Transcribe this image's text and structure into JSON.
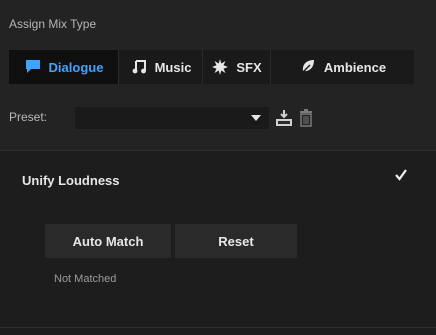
{
  "panel": {
    "title": "Assign Mix Type"
  },
  "tabs": [
    {
      "label": "Dialogue",
      "icon": "speech-bubble-icon",
      "active": true
    },
    {
      "label": "Music",
      "icon": "music-note-icon",
      "active": false
    },
    {
      "label": "SFX",
      "icon": "burst-icon",
      "active": false
    },
    {
      "label": "Ambience",
      "icon": "leaf-icon",
      "active": false
    }
  ],
  "preset": {
    "label": "Preset:",
    "value": ""
  },
  "unify": {
    "label": "Unify Loudness",
    "checked": true
  },
  "buttons": {
    "auto_match": "Auto Match",
    "reset": "Reset"
  },
  "status": {
    "text": "Not Matched"
  },
  "colors": {
    "accent": "#3ea4ff",
    "background": "#1d1d1d",
    "panel": "#232323"
  }
}
